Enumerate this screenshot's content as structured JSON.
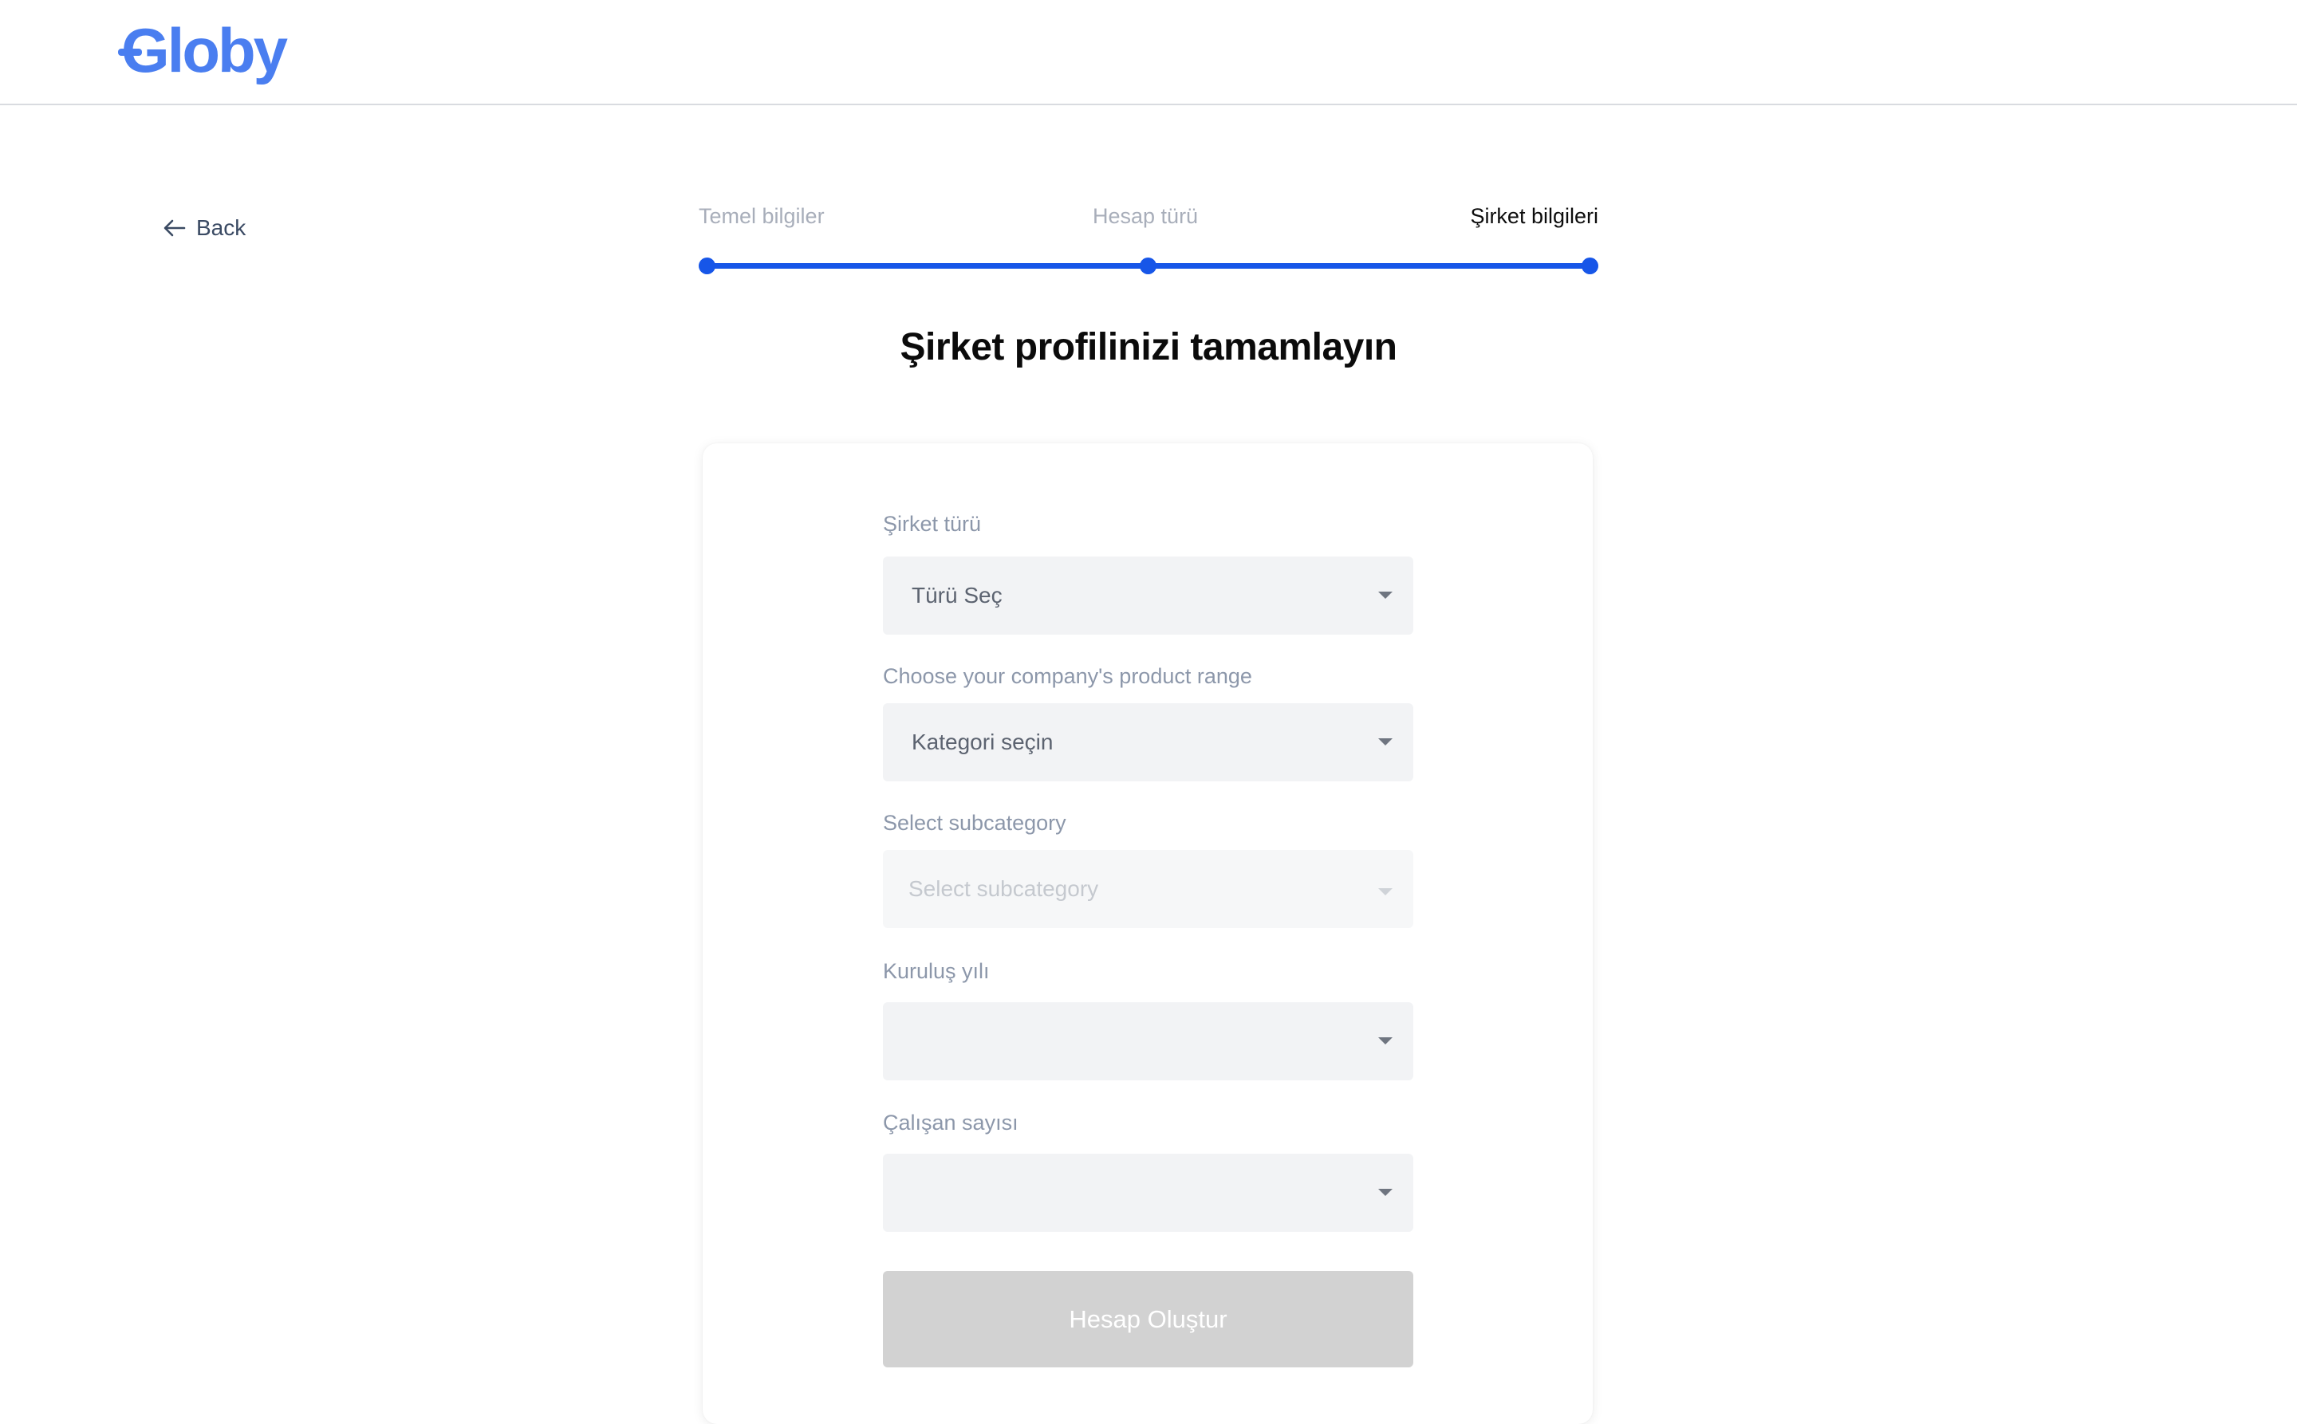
{
  "brand": {
    "logo_text": "Globy",
    "accent_color": "#4a7ef0"
  },
  "nav": {
    "back_label": "Back"
  },
  "stepper": {
    "steps": [
      {
        "label": "Temel bilgiler",
        "state": "completed"
      },
      {
        "label": "Hesap türü",
        "state": "completed"
      },
      {
        "label": "Şirket bilgileri",
        "state": "current"
      }
    ],
    "progress_color": "#1756e8"
  },
  "page": {
    "title": "Şirket profilinizi tamamlayın"
  },
  "form": {
    "company_type": {
      "label": "Şirket türü",
      "value": "Türü Seç"
    },
    "product_range": {
      "label": "Choose your company's product range",
      "value": "Kategori seçin"
    },
    "subcategory": {
      "label": "Select subcategory",
      "placeholder": "Select subcategory",
      "disabled": true
    },
    "founding_year": {
      "label": "Kuruluş yılı",
      "value": ""
    },
    "employee_count": {
      "label": "Çalışan sayısı",
      "value": ""
    },
    "submit_label": "Hesap Oluştur",
    "submit_disabled": true
  }
}
